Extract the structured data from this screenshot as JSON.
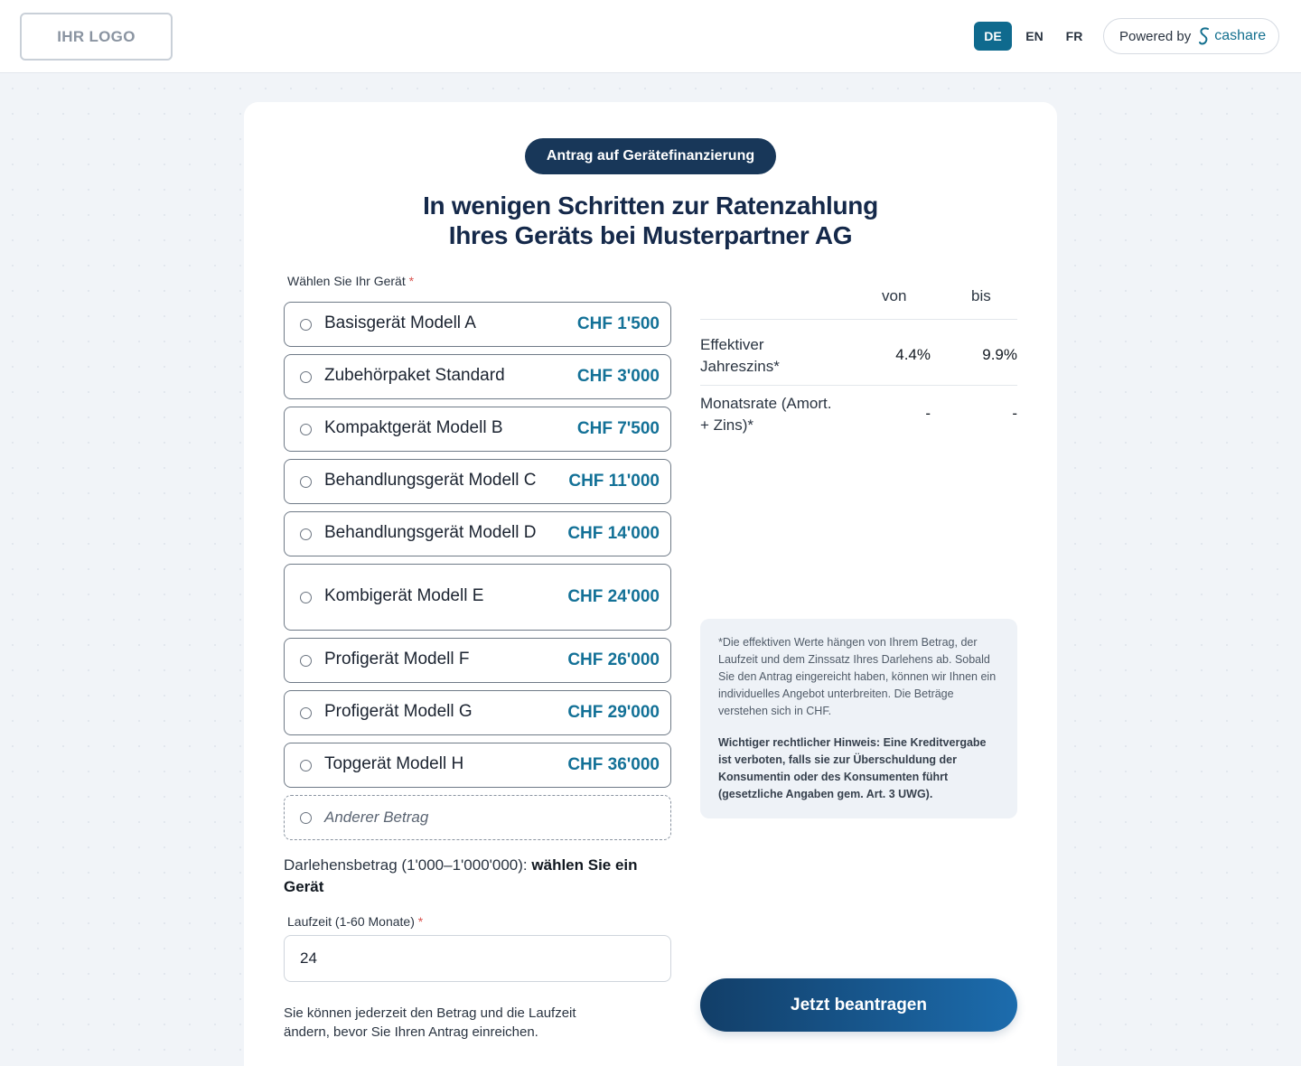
{
  "header": {
    "logo_text": "IHR LOGO",
    "languages": [
      "DE",
      "EN",
      "FR"
    ],
    "active_language": "DE",
    "powered_by": "Powered by",
    "brand_name": "cashare",
    "brand_icon": "cashare-s-icon"
  },
  "card": {
    "badge": "Antrag auf Gerätefinanzierung",
    "title_line1": "In wenigen Schritten zur Ratenzahlung",
    "title_line2": "Ihres Geräts bei Musterpartner AG",
    "device_label": "Wählen Sie Ihr Gerät",
    "required_mark": "*",
    "devices": [
      {
        "name": "Basisgerät Modell A",
        "price": "CHF 1'500"
      },
      {
        "name": "Zubehörpaket Standard",
        "price": "CHF 3'000"
      },
      {
        "name": "Kompaktgerät Modell B",
        "price": "CHF 7'500"
      },
      {
        "name": "Behandlungsgerät Modell C",
        "price": "CHF 11'000"
      },
      {
        "name": "Behandlungsgerät Modell D",
        "price": "CHF 14'000"
      },
      {
        "name": "Kombigerät Modell E",
        "price": "CHF 24'000"
      },
      {
        "name": "Profigerät Modell F",
        "price": "CHF 26'000"
      },
      {
        "name": "Profigerät Modell G",
        "price": "CHF 29'000"
      },
      {
        "name": "Topgerät Modell H",
        "price": "CHF 36'000"
      }
    ],
    "other_amount": "Anderer Betrag",
    "loan_amount_prefix": "Darlehensbetrag (1'000–1'000'000):",
    "loan_amount_value": "wählen Sie ein Gerät",
    "term_label": "Laufzeit (1-60 Monate)",
    "term_value": "24",
    "note": "Sie können jederzeit den Betrag und die Laufzeit ändern, bevor Sie Ihren Antrag einreichen."
  },
  "rates": {
    "col_from": "von",
    "col_to": "bis",
    "rows": [
      {
        "label": "Effektiver Jahreszins*",
        "from": "4.4%",
        "to": "9.9%"
      },
      {
        "label": "Monatsrate (Amort. + Zins)*",
        "from": "-",
        "to": "-"
      }
    ]
  },
  "info": {
    "text": "*Die effektiven Werte hängen von Ihrem Betrag, der Laufzeit und dem Zinssatz Ihres Darlehens ab. Sobald Sie den Antrag eingereicht haben, können wir Ihnen ein individuelles Angebot unterbreiten. Die Beträge verstehen sich in CHF.",
    "legal": "Wichtiger rechtlicher Hinweis: Eine Kreditvergabe ist verboten, falls sie zur Überschuldung der Konsumentin oder des Konsumenten führt (gesetzliche Angaben gem. Art. 3 UWG)."
  },
  "cta": {
    "label": "Jetzt beantragen"
  },
  "colors": {
    "accent": "#0f6a8e",
    "navy": "#183759",
    "price": "#137197"
  }
}
